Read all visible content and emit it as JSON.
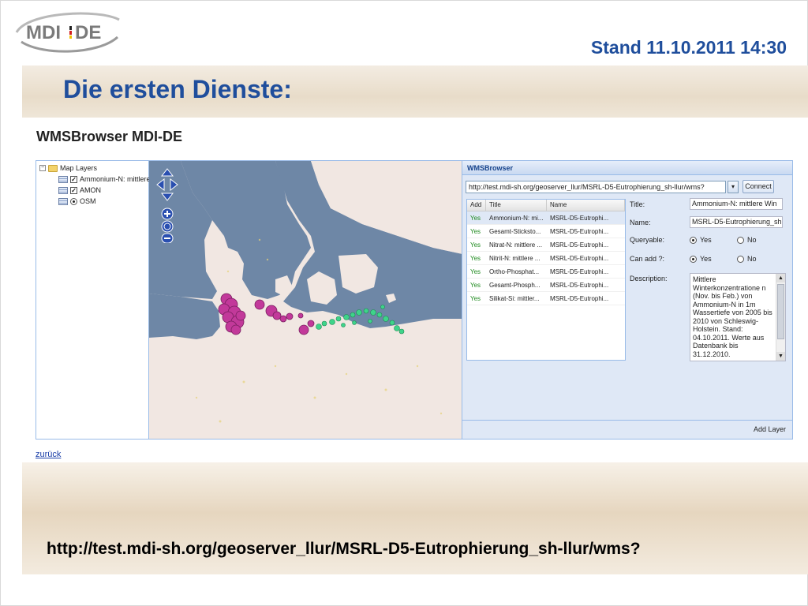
{
  "slide": {
    "logo_text": "MDI DE",
    "stand": "Stand 11.10.2011 14:30",
    "title": "Die ersten Dienste:",
    "bottom_url": "http://test.mdi-sh.org/geoserver_llur/MSRL-D5-Eutrophierung_sh-llur/wms?"
  },
  "app": {
    "title": "WMSBrowser MDI-DE",
    "back_link": "zurück"
  },
  "tree": {
    "root": "Map Layers",
    "layers": [
      {
        "label": "Ammonium-N: mittlere",
        "type": "checkbox",
        "checked": true
      },
      {
        "label": "AMON",
        "type": "checkbox",
        "checked": true
      },
      {
        "label": "OSM",
        "type": "radio",
        "checked": true
      }
    ]
  },
  "wms": {
    "panel_title": "WMSBrowser",
    "url": "http://test.mdi-sh.org/geoserver_llur/MSRL-D5-Eutrophierung_sh-llur/wms?",
    "connect_label": "Connect",
    "columns": {
      "add": "Add",
      "title": "Title",
      "name": "Name"
    },
    "rows": [
      {
        "add": "Yes",
        "title": "Ammonium-N: mi...",
        "name": "MSRL-D5-Eutrophi...",
        "selected": true
      },
      {
        "add": "Yes",
        "title": "Gesamt-Sticksto...",
        "name": "MSRL-D5-Eutrophi..."
      },
      {
        "add": "Yes",
        "title": "Nitrat-N: mittlere ...",
        "name": "MSRL-D5-Eutrophi..."
      },
      {
        "add": "Yes",
        "title": "Nitrit-N: mittlere ...",
        "name": "MSRL-D5-Eutrophi..."
      },
      {
        "add": "Yes",
        "title": "Ortho-Phosphat...",
        "name": "MSRL-D5-Eutrophi..."
      },
      {
        "add": "Yes",
        "title": "Gesamt-Phosph...",
        "name": "MSRL-D5-Eutrophi..."
      },
      {
        "add": "Yes",
        "title": "Silikat-Si: mittler...",
        "name": "MSRL-D5-Eutrophi..."
      }
    ],
    "form": {
      "title_label": "Title:",
      "title_value": "Ammonium-N: mittlere Win",
      "name_label": "Name:",
      "name_value": "MSRL-D5-Eutrophierung_sh",
      "queryable_label": "Queryable:",
      "can_add_label": "Can add ?:",
      "yes": "Yes",
      "no": "No",
      "description_label": "Description:",
      "description": "Mittlere Winterkonzentratione n (Nov. bis Feb.) von Ammonium-N in 1m Wassertiefe von 2005 bis 2010 von Schleswig-Holstein. Stand: 04.10.2011. Werte aus Datenbank bis 31.12.2010."
    },
    "add_layer_label": "Add Layer"
  },
  "colors": {
    "title_blue": "#1f4e9c",
    "sea": "#6e87a6",
    "land": "#f1e7e2",
    "marker_magenta": "#c2399a",
    "marker_green": "#3ed48a"
  }
}
